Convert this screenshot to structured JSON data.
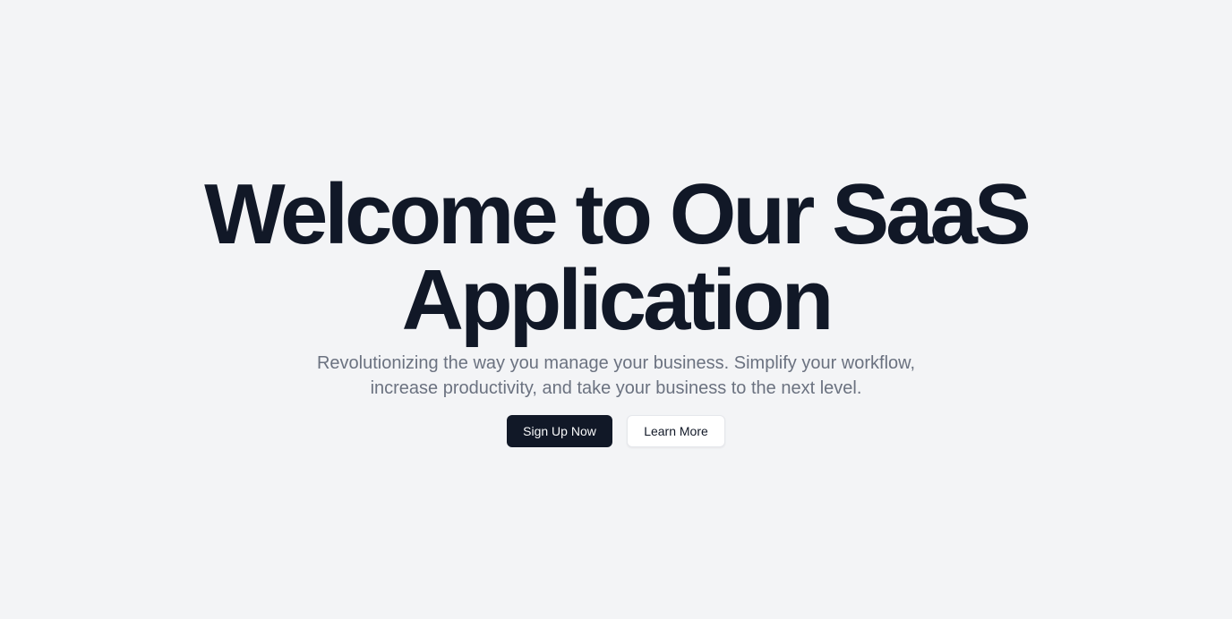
{
  "hero": {
    "title_line1": "Welcome to Our SaaS",
    "title_line2": "Application",
    "subtitle": "Revolutionizing the way you manage your business. Simplify your workflow, increase productivity, and take your business to the next level."
  },
  "cta": {
    "primary_label": "Sign Up Now",
    "secondary_label": "Learn More"
  },
  "colors": {
    "background": "#f3f4f6",
    "heading": "#111827",
    "subtitle": "#6b7280",
    "primary_button": "#111827",
    "secondary_button": "#ffffff"
  }
}
